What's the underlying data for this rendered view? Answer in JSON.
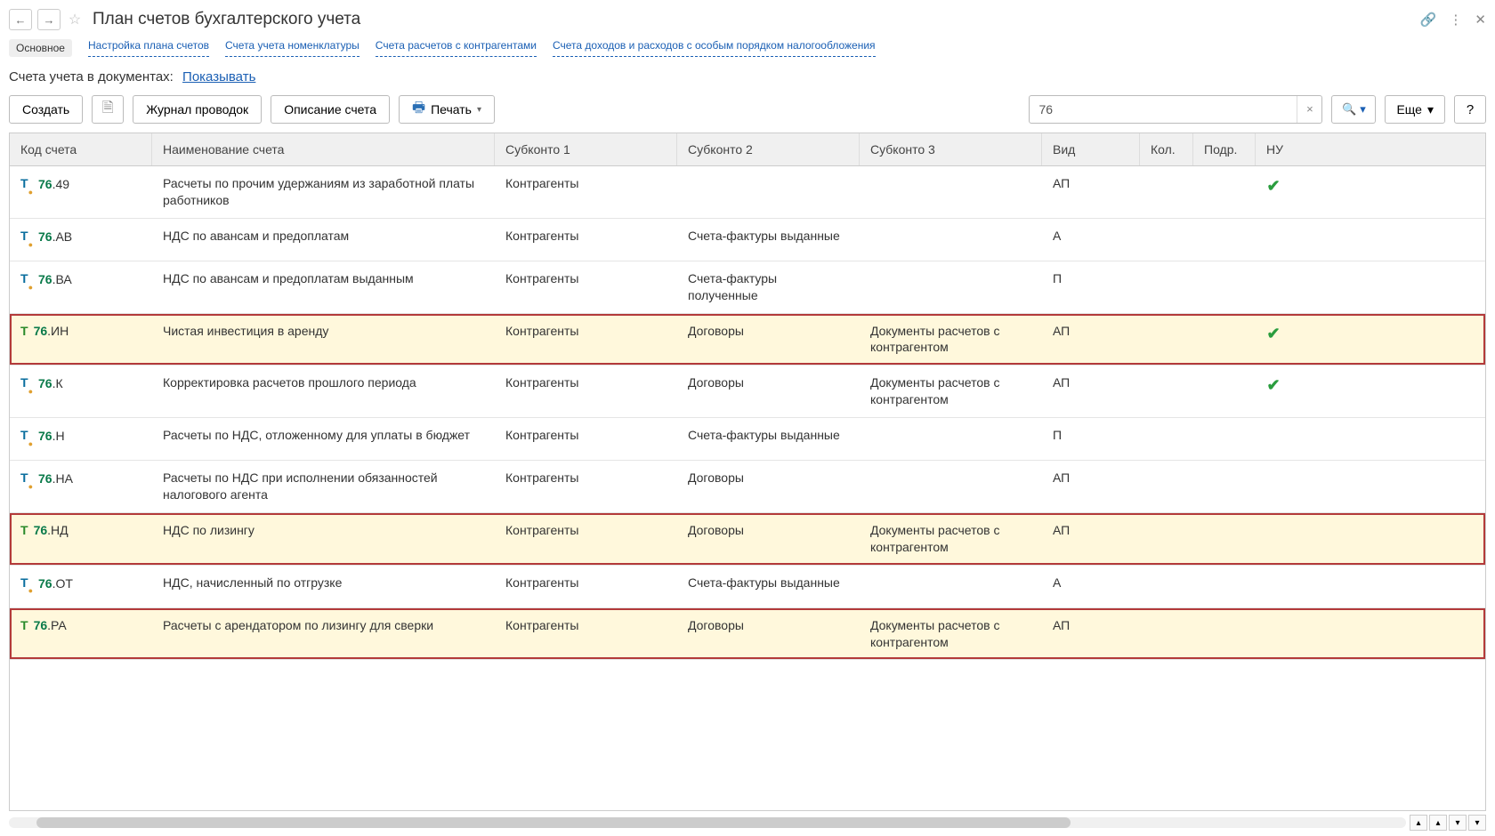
{
  "title": "План счетов бухгалтерского учета",
  "tabs": [
    "Основное",
    "Настройка плана счетов",
    "Счета учета номенклатуры",
    "Счета расчетов с контрагентами",
    "Счета доходов и расходов с особым порядком налогообложения"
  ],
  "subline": {
    "label": "Счета учета в документах:",
    "link": "Показывать"
  },
  "toolbar": {
    "create": "Создать",
    "journal": "Журнал проводок",
    "desc": "Описание счета",
    "print": "Печать",
    "more": "Еще",
    "help": "?",
    "search_value": "76"
  },
  "columns": {
    "code": "Код счета",
    "name": "Наименование счета",
    "s1": "Субконто 1",
    "s2": "Субконто 2",
    "s3": "Субконто 3",
    "vid": "Вид",
    "kol": "Кол.",
    "podr": "Подр.",
    "nu": "НУ"
  },
  "rows": [
    {
      "t": "To",
      "bold": "76",
      "suf": ".49",
      "name": "Расчеты по прочим удержаниям из заработной платы работников",
      "s1": "Контрагенты",
      "s2": "",
      "s3": "",
      "vid": "АП",
      "nu": true,
      "hl": false
    },
    {
      "t": "To",
      "bold": "76",
      "suf": ".АВ",
      "name": "НДС по авансам и предоплатам",
      "s1": "Контрагенты",
      "s2": "Счета-фактуры выданные",
      "s3": "",
      "vid": "А",
      "nu": false,
      "hl": false
    },
    {
      "t": "To",
      "bold": "76",
      "suf": ".ВА",
      "name": "НДС по авансам и предоплатам выданным",
      "s1": "Контрагенты",
      "s2": "Счета-фактуры полученные",
      "s3": "",
      "vid": "П",
      "nu": false,
      "hl": false
    },
    {
      "t": "T",
      "bold": "76",
      "suf": ".ИН",
      "name": "Чистая инвестиция в аренду",
      "s1": "Контрагенты",
      "s2": "Договоры",
      "s3": "Документы расчетов с контрагентом",
      "vid": "АП",
      "nu": true,
      "hl": true
    },
    {
      "t": "To",
      "bold": "76",
      "suf": ".К",
      "name": "Корректировка расчетов прошлого периода",
      "s1": "Контрагенты",
      "s2": "Договоры",
      "s3": "Документы расчетов с контрагентом",
      "vid": "АП",
      "nu": true,
      "hl": false
    },
    {
      "t": "To",
      "bold": "76",
      "suf": ".Н",
      "name": "Расчеты по НДС, отложенному для уплаты в бюджет",
      "s1": "Контрагенты",
      "s2": "Счета-фактуры выданные",
      "s3": "",
      "vid": "П",
      "nu": false,
      "hl": false
    },
    {
      "t": "To",
      "bold": "76",
      "suf": ".НА",
      "name": "Расчеты по НДС при исполнении обязанностей налогового агента",
      "s1": "Контрагенты",
      "s2": "Договоры",
      "s3": "",
      "vid": "АП",
      "nu": false,
      "hl": false
    },
    {
      "t": "T",
      "bold": "76",
      "suf": ".НД",
      "name": "НДС по лизингу",
      "s1": "Контрагенты",
      "s2": "Договоры",
      "s3": "Документы расчетов с контрагентом",
      "vid": "АП",
      "nu": false,
      "hl": true
    },
    {
      "t": "To",
      "bold": "76",
      "suf": ".ОТ",
      "name": "НДС, начисленный по отгрузке",
      "s1": "Контрагенты",
      "s2": "Счета-фактуры выданные",
      "s3": "",
      "vid": "А",
      "nu": false,
      "hl": false
    },
    {
      "t": "T",
      "bold": "76",
      "suf": ".РА",
      "name": "Расчеты с арендатором по лизингу для сверки",
      "s1": "Контрагенты",
      "s2": "Договоры",
      "s3": "Документы расчетов с контрагентом",
      "vid": "АП",
      "nu": false,
      "hl": true
    }
  ]
}
